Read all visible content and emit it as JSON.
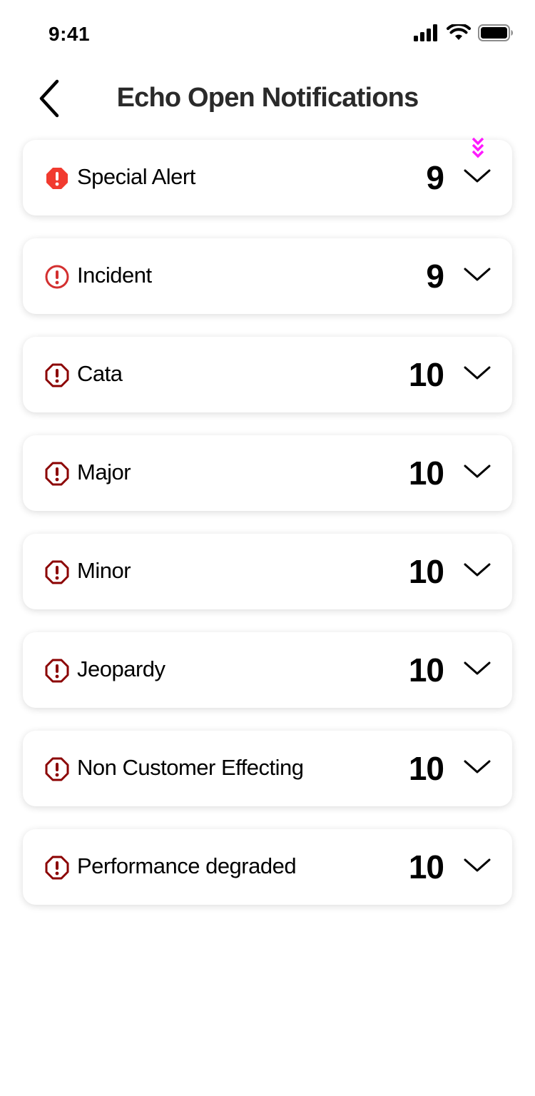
{
  "status_bar": {
    "time": "9:41"
  },
  "header": {
    "title": "Echo Open Notifications"
  },
  "colors": {
    "special_alert": "#f13a2f",
    "incident": "#d32f2f",
    "severity": "#8b0000",
    "indicator": "#ff1aff"
  },
  "notifications": [
    {
      "label": "Special Alert",
      "count": "9",
      "icon": "alert-octagon-filled-icon"
    },
    {
      "label": "Incident",
      "count": "9",
      "icon": "alert-circle-icon"
    },
    {
      "label": "Cata",
      "count": "10",
      "icon": "alert-octagon-icon"
    },
    {
      "label": "Major",
      "count": "10",
      "icon": "alert-octagon-icon"
    },
    {
      "label": "Minor",
      "count": "10",
      "icon": "alert-octagon-icon"
    },
    {
      "label": "Jeopardy",
      "count": "10",
      "icon": "alert-octagon-icon"
    },
    {
      "label": "Non Customer Effecting",
      "count": "10",
      "icon": "alert-octagon-icon"
    },
    {
      "label": "Performance degraded",
      "count": "10",
      "icon": "alert-octagon-icon"
    }
  ]
}
